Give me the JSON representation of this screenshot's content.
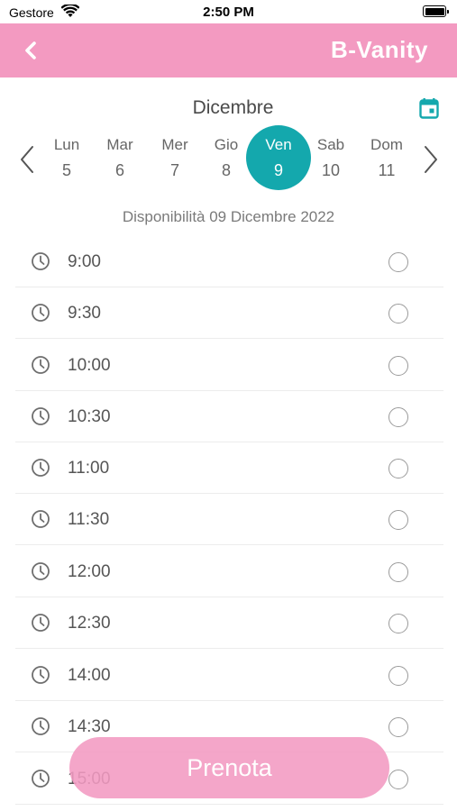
{
  "status_bar": {
    "carrier": "Gestore",
    "time": "2:50 PM"
  },
  "nav": {
    "title": "B-Vanity",
    "accent_color": "#f39ac1"
  },
  "calendar": {
    "month": "Dicembre",
    "selected_color": "#14a8ad",
    "days": [
      {
        "name": "Lun",
        "num": "5"
      },
      {
        "name": "Mar",
        "num": "6"
      },
      {
        "name": "Mer",
        "num": "7"
      },
      {
        "name": "Gio",
        "num": "8"
      },
      {
        "name": "Ven",
        "num": "9",
        "selected": true
      },
      {
        "name": "Sab",
        "num": "10"
      },
      {
        "name": "Dom",
        "num": "11"
      }
    ]
  },
  "availability_label": "Disponibilità 09 Dicembre 2022",
  "slots": [
    {
      "time": "9:00"
    },
    {
      "time": "9:30"
    },
    {
      "time": "10:00"
    },
    {
      "time": "10:30"
    },
    {
      "time": "11:00"
    },
    {
      "time": "11:30"
    },
    {
      "time": "12:00"
    },
    {
      "time": "12:30"
    },
    {
      "time": "14:00"
    },
    {
      "time": "14:30"
    },
    {
      "time": "15:00"
    }
  ],
  "book_button": {
    "label": "Prenota"
  }
}
